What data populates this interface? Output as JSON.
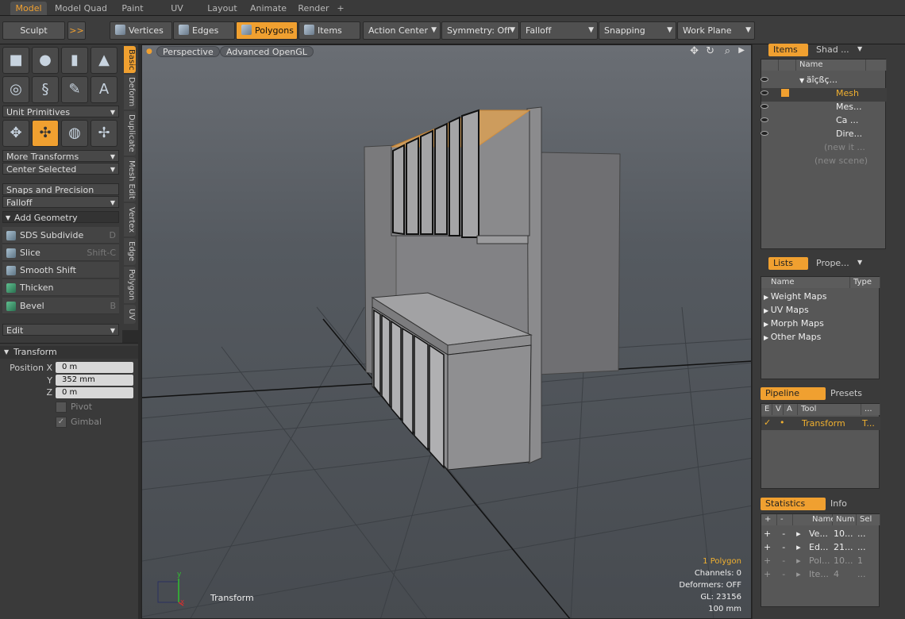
{
  "top_tabs": [
    "Model",
    "Model Quad",
    "Paint",
    "UV",
    "Layout",
    "Animate",
    "Render"
  ],
  "top_tabs_active": "Model",
  "add_tab": "+",
  "toolbar": {
    "sculpt": "Sculpt",
    "expand": ">>",
    "vertices": "Vertices",
    "edges": "Edges",
    "polygons": "Polygons",
    "items": "Items",
    "action_center": "Action Center",
    "symmetry": "Symmetry: Off",
    "falloff": "Falloff",
    "snapping": "Snapping",
    "work_plane": "Work Plane"
  },
  "left": {
    "unit_primitives": "Unit Primitives",
    "more_transforms": "More Transforms",
    "center_selected": "Center Selected",
    "snaps_precision": "Snaps and Precision",
    "falloff": "Falloff",
    "add_geometry": "Add Geometry",
    "geometry_tools": [
      {
        "label": "SDS Subdivide",
        "shortcut": "D"
      },
      {
        "label": "Slice",
        "shortcut": "Shift-C"
      },
      {
        "label": "Smooth Shift",
        "shortcut": ""
      },
      {
        "label": "Thicken",
        "shortcut": ""
      },
      {
        "label": "Bevel",
        "shortcut": "B"
      }
    ],
    "edit": "Edit"
  },
  "vertical_tabs": [
    "Basic",
    "Deform",
    "Duplicate",
    "Mesh Edit",
    "Vertex",
    "Edge",
    "Polygon",
    "UV"
  ],
  "properties": {
    "section": "Transform",
    "position_label": "Position X",
    "y_label": "Y",
    "z_label": "Z",
    "x_value": "0 m",
    "y_value": "352 mm",
    "z_value": "0 m",
    "pivot": "Pivot",
    "gimbal": "Gimbal"
  },
  "viewport": {
    "perspective": "Perspective",
    "renderer": "Advanced OpenGL",
    "tool_label": "Transform",
    "axis_x": "x",
    "axis_y": "y",
    "stats": {
      "polygons": "1 Polygon",
      "channels": "Channels: 0",
      "deformers": "Deformers: OFF",
      "gl": "GL: 23156",
      "scale": "100 mm"
    }
  },
  "items_panel": {
    "tabs": [
      "Items",
      "Shad ..."
    ],
    "header_name": "Name",
    "rows": [
      {
        "name": "äîçßç...",
        "indent": 0
      },
      {
        "name": "Mesh",
        "indent": 1,
        "selected": true
      },
      {
        "name": "Mes...",
        "indent": 1
      },
      {
        "name": "Ca ...",
        "indent": 1
      },
      {
        "name": "Dire...",
        "indent": 1
      },
      {
        "name": "(new it ...",
        "indent": 1
      },
      {
        "name": "(new scene)",
        "indent": 0
      }
    ]
  },
  "lists_panel": {
    "tabs": [
      "Lists",
      "Prope..."
    ],
    "header_name": "Name",
    "header_type": "Type",
    "items": [
      "Weight Maps",
      "UV Maps",
      "Morph Maps",
      "Other Maps"
    ]
  },
  "pipeline_panel": {
    "tabs": [
      "Pipeline",
      "Presets"
    ],
    "headers": [
      "E",
      "V",
      "A",
      "Tool",
      "..."
    ],
    "row": {
      "tool": "Transform",
      "extra": "T..."
    }
  },
  "stats_panel": {
    "tabs": [
      "Statistics",
      "Info"
    ],
    "headers": [
      "+",
      "-",
      "Name",
      "Num",
      "Sel"
    ],
    "rows": [
      {
        "name": "Ve...",
        "num": "10...",
        "sel": "..."
      },
      {
        "name": "Ed...",
        "num": "21...",
        "sel": "..."
      },
      {
        "name": "Pol...",
        "num": "10...",
        "sel": "1"
      },
      {
        "name": "Ite...",
        "num": "4",
        "sel": "..."
      }
    ]
  },
  "colors": {
    "accent": "#f0a030",
    "panel": "#3a3a3a",
    "viewport_top": "#6a6e74"
  }
}
